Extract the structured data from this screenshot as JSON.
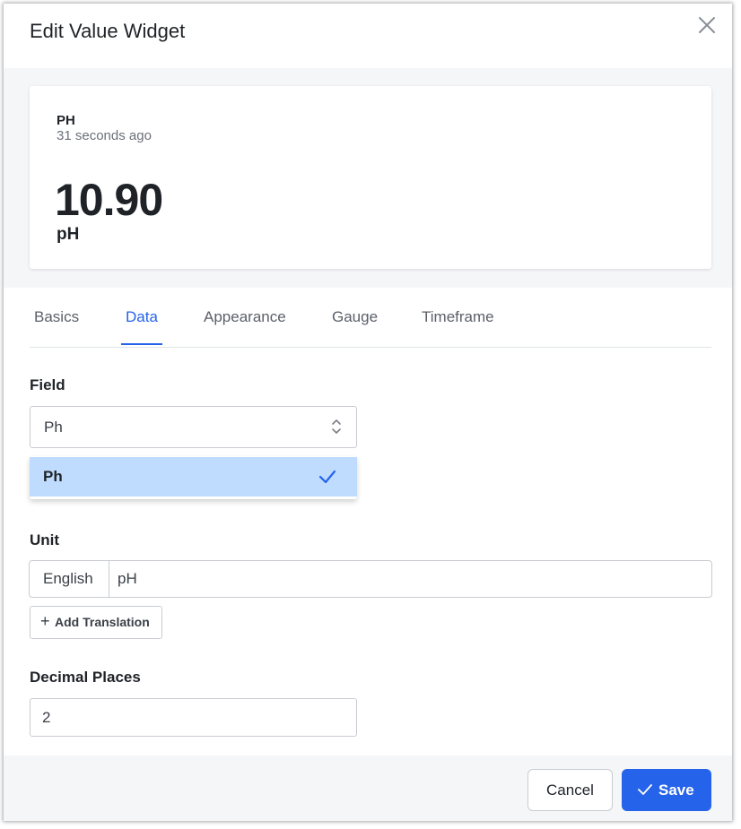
{
  "dialog": {
    "title": "Edit Value Widget",
    "close_icon": "close-x-icon"
  },
  "preview": {
    "name": "PH",
    "updated": "31 seconds ago",
    "value": "10.90",
    "unit": "pH"
  },
  "tabs": [
    {
      "label": "Basics",
      "active": false
    },
    {
      "label": "Data",
      "active": true
    },
    {
      "label": "Appearance",
      "active": false
    },
    {
      "label": "Gauge",
      "active": false
    },
    {
      "label": "Timeframe",
      "active": false
    }
  ],
  "field": {
    "label": "Field",
    "selected": "Ph",
    "options": [
      {
        "label": "Ph",
        "selected": true
      }
    ]
  },
  "unit": {
    "label": "Unit",
    "language": "English",
    "value": "pH",
    "add_translation_label": "Add Translation"
  },
  "decimal_places": {
    "label": "Decimal Places",
    "value": "2"
  },
  "footer": {
    "cancel_label": "Cancel",
    "save_label": "Save"
  },
  "colors": {
    "accent": "#2563eb",
    "selected_option_bg": "#bfdbfe",
    "panel_bg": "#f5f6f8"
  }
}
